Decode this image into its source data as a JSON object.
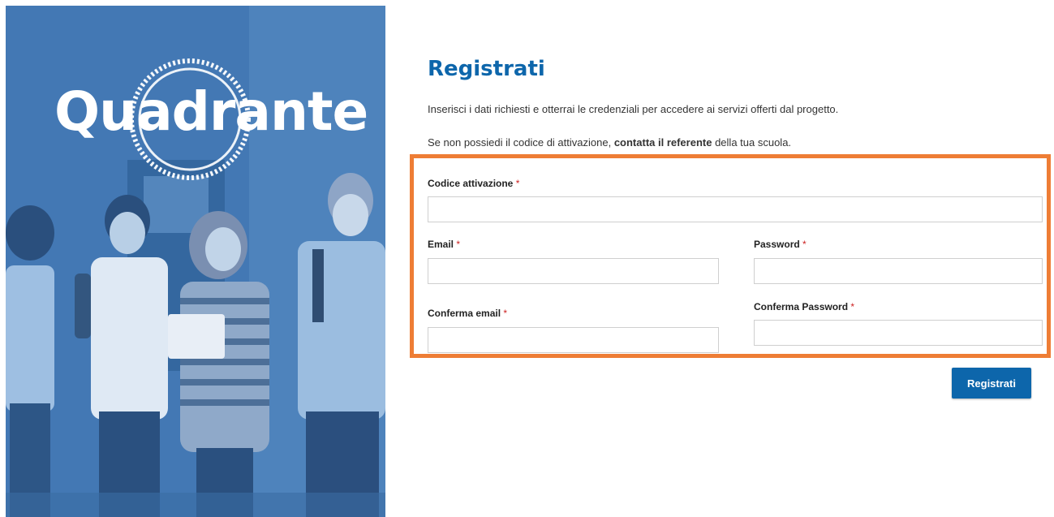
{
  "brand": {
    "logo_text": "Quadrante"
  },
  "page": {
    "title": "Registrati",
    "intro": "Inserisci i dati richiesti e otterrai le credenziali per accedere ai servizi offerti dal progetto.",
    "note_prefix": "Se non possiedi il codice di attivazione, ",
    "note_bold": "contatta il referente",
    "note_suffix": " della tua scuola."
  },
  "form": {
    "required_marker": "*",
    "activation_code": {
      "label": "Codice attivazione",
      "value": ""
    },
    "email": {
      "label": "Email",
      "value": ""
    },
    "password": {
      "label": "Password",
      "value": ""
    },
    "confirm_email": {
      "label": "Conferma email",
      "value": ""
    },
    "confirm_password": {
      "label": "Conferma Password",
      "value": ""
    },
    "submit_label": "Registrati"
  },
  "colors": {
    "accent": "#0d66ab",
    "highlight": "#ee7d35",
    "required": "#cc2222",
    "hero": "#3d72ad"
  }
}
